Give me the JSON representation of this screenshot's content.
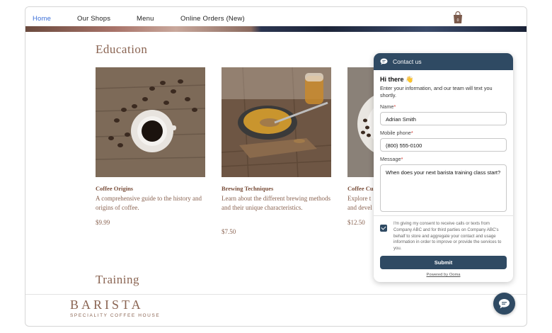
{
  "nav": {
    "items": [
      {
        "label": "Home",
        "active": true
      },
      {
        "label": "Our Shops",
        "active": false
      },
      {
        "label": "Menu",
        "active": false
      },
      {
        "label": "Online Orders (New)",
        "active": false
      }
    ],
    "cart_icon": "shopping-bag-icon",
    "cart_count": "0"
  },
  "education": {
    "title": "Education",
    "cards": [
      {
        "title": "Coffee Origins",
        "desc": "A comprehensive guide to the history and origins of coffee.",
        "price": "$9.99"
      },
      {
        "title": "Brewing Techniques",
        "desc": "Learn about the different brewing methods and their unique characteristics.",
        "price": "$7.50"
      },
      {
        "title": "Coffee Cu",
        "desc": "Explore t and devel",
        "price": "$12.50"
      }
    ]
  },
  "training": {
    "title": "Training"
  },
  "footer": {
    "brand": "BARISTA",
    "tagline": "SPECIALITY COFFEE HOUSE"
  },
  "widget": {
    "header": "Contact us",
    "greeting": "Hi there 👋",
    "intro": "Enter your information, and our team will text you shortly.",
    "name_label": "Name",
    "name_value": "Adrian Smith",
    "phone_label": "Mobile phone",
    "phone_value": "(800) 555-0100",
    "message_label": "Message",
    "message_value": "When does your next barista training class start?",
    "required_mark": "*",
    "consent_checked": true,
    "consent_text": "I'm giving my consent to receive calls or texts from Company ABC and for third parties on Company ABC's behalf to store and aggregate your contact and usage information in order to improve or provide the services to you.",
    "submit_label": "Submit",
    "powered_by": "Powered by Ooma"
  },
  "colors": {
    "accent": "#2f4a63",
    "brand": "#8a6452",
    "nav_active": "#3b6fd8"
  }
}
